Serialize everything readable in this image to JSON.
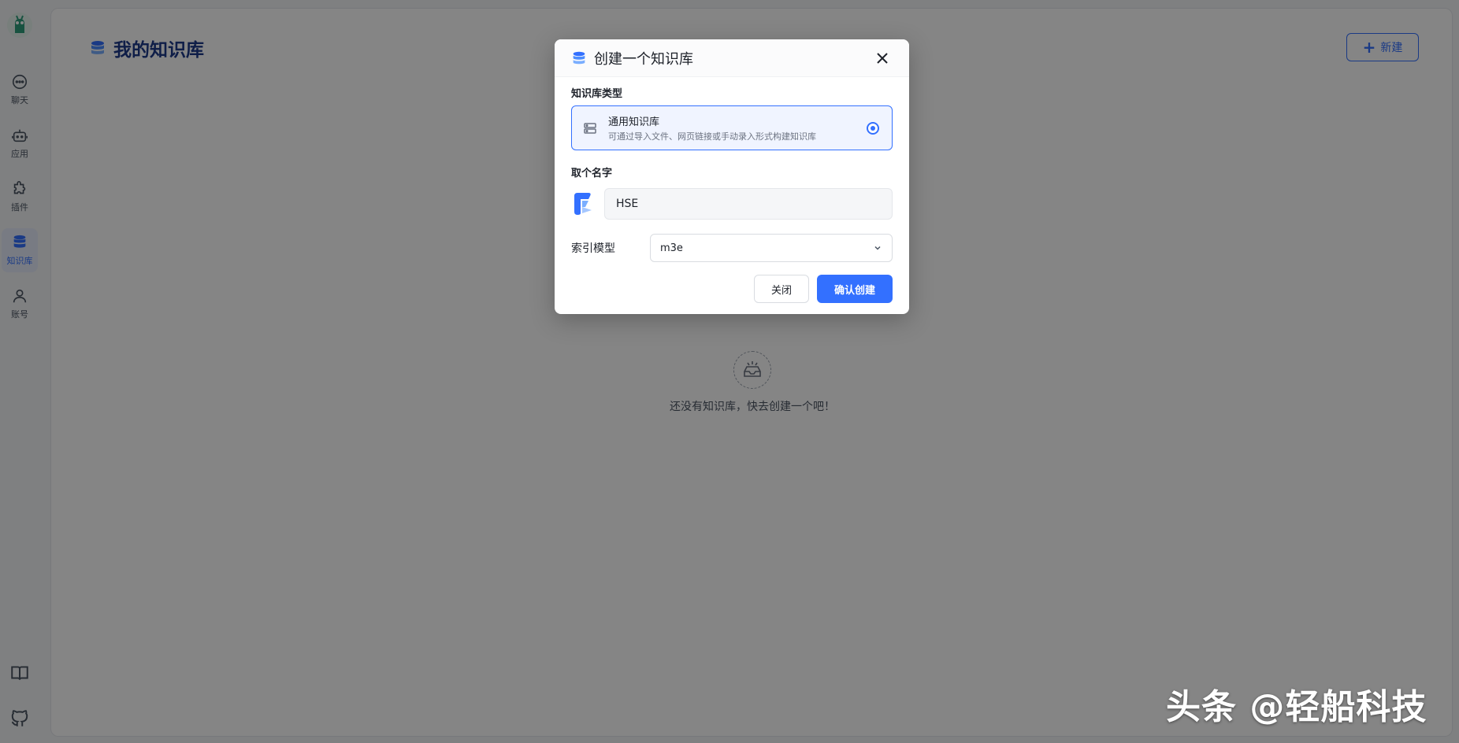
{
  "sidebar": {
    "items": [
      {
        "label": "聊天",
        "icon": "chat-icon"
      },
      {
        "label": "应用",
        "icon": "robot-icon"
      },
      {
        "label": "插件",
        "icon": "puzzle-icon"
      },
      {
        "label": "知识库",
        "icon": "database-icon",
        "active": true
      },
      {
        "label": "账号",
        "icon": "user-icon"
      }
    ],
    "bottom_icons": [
      "book-icon",
      "github-icon"
    ]
  },
  "page": {
    "title": "我的知识库",
    "new_button": "新建",
    "empty_text": "还没有知识库，快去创建一个吧！"
  },
  "modal": {
    "title": "创建一个知识库",
    "type_section_label": "知识库类型",
    "type_option": {
      "name": "通用知识库",
      "description": "可通过导入文件、网页链接或手动录入形式构建知识库",
      "selected": true
    },
    "name_section_label": "取个名字",
    "name_value": "HSE",
    "model_label": "索引模型",
    "model_value": "m3e",
    "close_button": "关闭",
    "confirm_button": "确认创建"
  },
  "watermark": "头条 @轻船科技",
  "colors": {
    "primary": "#3370ff",
    "title_blue": "#1e3a8a",
    "overlay": "rgba(0,0,0,0.48)"
  }
}
